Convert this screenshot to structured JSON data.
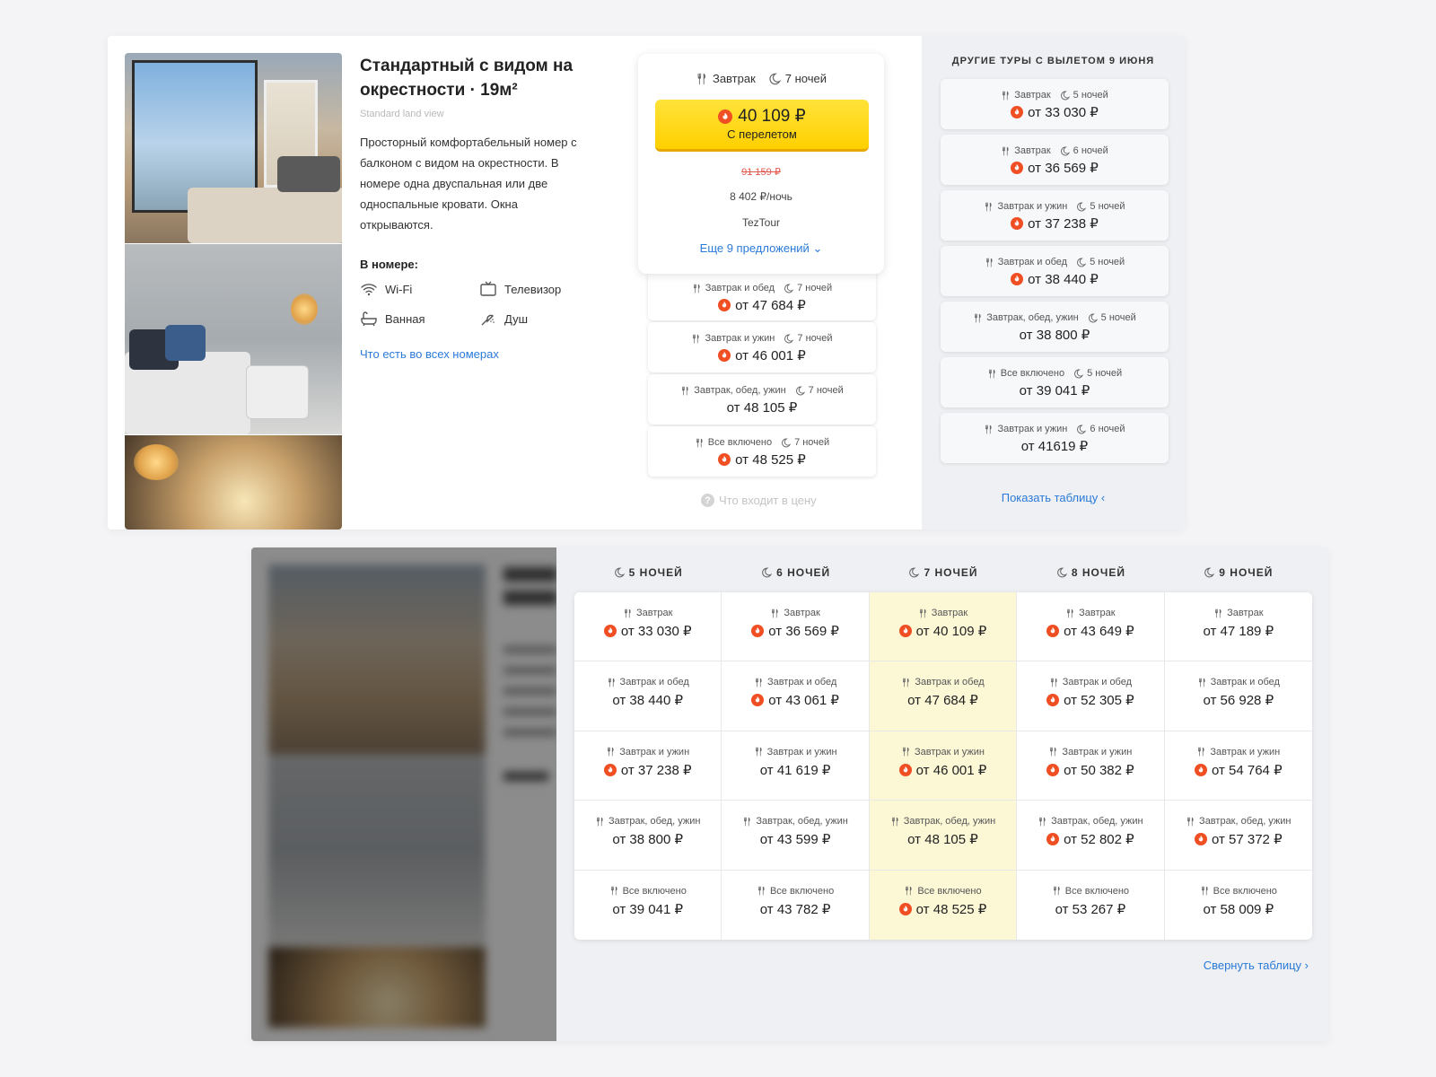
{
  "room": {
    "title": "Стандартный с видом на окрестности · 19м²",
    "subtitle": "Standard land view",
    "description": "Просторный комфортабельный номер с балконом с видом на окрестности. В номере одна двуспальная или две односпальные кровати. Окна открываются.",
    "in_room_label": "В номере:",
    "amenities": [
      {
        "label": "Wi-Fi",
        "icon": "wifi-icon"
      },
      {
        "label": "Телевизор",
        "icon": "tv-icon"
      },
      {
        "label": "Ванная",
        "icon": "bathtub-icon"
      },
      {
        "label": "Душ",
        "icon": "shower-icon"
      }
    ],
    "all_rooms_link": "Что есть во всех номерах"
  },
  "main_offer": {
    "meal": "Завтрак",
    "nights": "7 ночей",
    "price": "40 109 ₽",
    "price_sub": "С перелетом",
    "old_price": "91 159 ₽",
    "per_night": "8 402 ₽/ночь",
    "operator": "TezTour",
    "more_offers": "Еще 9 предложений"
  },
  "offers": [
    {
      "meal": "Завтрак и обед",
      "nights": "7 ночей",
      "price": "от 47 684 ₽",
      "hot": true
    },
    {
      "meal": "Завтрак и ужин",
      "nights": "7 ночей",
      "price": "от 46 001 ₽",
      "hot": true
    },
    {
      "meal": "Завтрак, обед, ужин",
      "nights": "7 ночей",
      "price": "от 48 105 ₽",
      "hot": false
    },
    {
      "meal": "Все включено",
      "nights": "7 ночей",
      "price": "от 48 525 ₽",
      "hot": true
    }
  ],
  "whats_included": "Что входит в цену",
  "other_tours": {
    "title": "ДРУГИЕ ТУРЫ С ВЫЛЕТОМ 9 ИЮНЯ",
    "items": [
      {
        "meal": "Завтрак",
        "nights": "5 ночей",
        "price": "от 33 030 ₽",
        "hot": true
      },
      {
        "meal": "Завтрак",
        "nights": "6 ночей",
        "price": "от 36 569 ₽",
        "hot": true
      },
      {
        "meal": "Завтрак и ужин",
        "nights": "5 ночей",
        "price": "от 37 238 ₽",
        "hot": true
      },
      {
        "meal": "Завтрак и обед",
        "nights": "5 ночей",
        "price": "от 38 440 ₽",
        "hot": true
      },
      {
        "meal": "Завтрак, обед, ужин",
        "nights": "5 ночей",
        "price": "от 38 800 ₽",
        "hot": false
      },
      {
        "meal": "Все включено",
        "nights": "5 ночей",
        "price": "от 39 041 ₽",
        "hot": false
      },
      {
        "meal": "Завтрак и ужин",
        "nights": "6 ночей",
        "price": "от 41619 ₽",
        "hot": false
      }
    ],
    "show_table": "Показать таблицу"
  },
  "table": {
    "headers": [
      "5 НОЧЕЙ",
      "6 НОЧЕЙ",
      "7 НОЧЕЙ",
      "8 НОЧЕЙ",
      "9 НОЧЕЙ"
    ],
    "highlight_column": 2,
    "rows": [
      [
        {
          "meal": "Завтрак",
          "price": "от 33 030 ₽",
          "hot": true
        },
        {
          "meal": "Завтрак",
          "price": "от 36 569 ₽",
          "hot": true
        },
        {
          "meal": "Завтрак",
          "price": "от 40 109 ₽",
          "hot": true
        },
        {
          "meal": "Завтрак",
          "price": "от 43 649 ₽",
          "hot": true
        },
        {
          "meal": "Завтрак",
          "price": "от 47 189 ₽",
          "hot": false
        }
      ],
      [
        {
          "meal": "Завтрак и обед",
          "price": "от 38 440 ₽",
          "hot": false
        },
        {
          "meal": "Завтрак и обед",
          "price": "от 43 061 ₽",
          "hot": true
        },
        {
          "meal": "Завтрак и обед",
          "price": "от 47 684 ₽",
          "hot": false
        },
        {
          "meal": "Завтрак и обед",
          "price": "от 52 305 ₽",
          "hot": true
        },
        {
          "meal": "Завтрак и обед",
          "price": "от 56 928 ₽",
          "hot": false
        }
      ],
      [
        {
          "meal": "Завтрак и ужин",
          "price": "от 37 238 ₽",
          "hot": true
        },
        {
          "meal": "Завтрак и ужин",
          "price": "от 41 619 ₽",
          "hot": false
        },
        {
          "meal": "Завтрак и ужин",
          "price": "от 46 001 ₽",
          "hot": true
        },
        {
          "meal": "Завтрак и ужин",
          "price": "от 50 382 ₽",
          "hot": true
        },
        {
          "meal": "Завтрак и ужин",
          "price": "от 54 764 ₽",
          "hot": true
        }
      ],
      [
        {
          "meal": "Завтрак, обед, ужин",
          "price": "от 38 800 ₽",
          "hot": false
        },
        {
          "meal": "Завтрак, обед, ужин",
          "price": "от 43 599 ₽",
          "hot": false
        },
        {
          "meal": "Завтрак, обед, ужин",
          "price": "от 48 105 ₽",
          "hot": false
        },
        {
          "meal": "Завтрак, обед, ужин",
          "price": "от 52 802 ₽",
          "hot": true
        },
        {
          "meal": "Завтрак, обед, ужин",
          "price": "от 57 372 ₽",
          "hot": true
        }
      ],
      [
        {
          "meal": "Все включено",
          "price": "от 39 041 ₽",
          "hot": false
        },
        {
          "meal": "Все включено",
          "price": "от 43 782 ₽",
          "hot": false
        },
        {
          "meal": "Все включено",
          "price": "от 48 525 ₽",
          "hot": true
        },
        {
          "meal": "Все включено",
          "price": "от 53 267 ₽",
          "hot": false
        },
        {
          "meal": "Все включено",
          "price": "от 58 009 ₽",
          "hot": false
        }
      ]
    ],
    "collapse": "Свернуть таблицу"
  },
  "colors": {
    "accent": "#2a7ad9",
    "price_button": "#ffd000",
    "highlight": "#fcf8d6",
    "hot": "#f04e23"
  }
}
